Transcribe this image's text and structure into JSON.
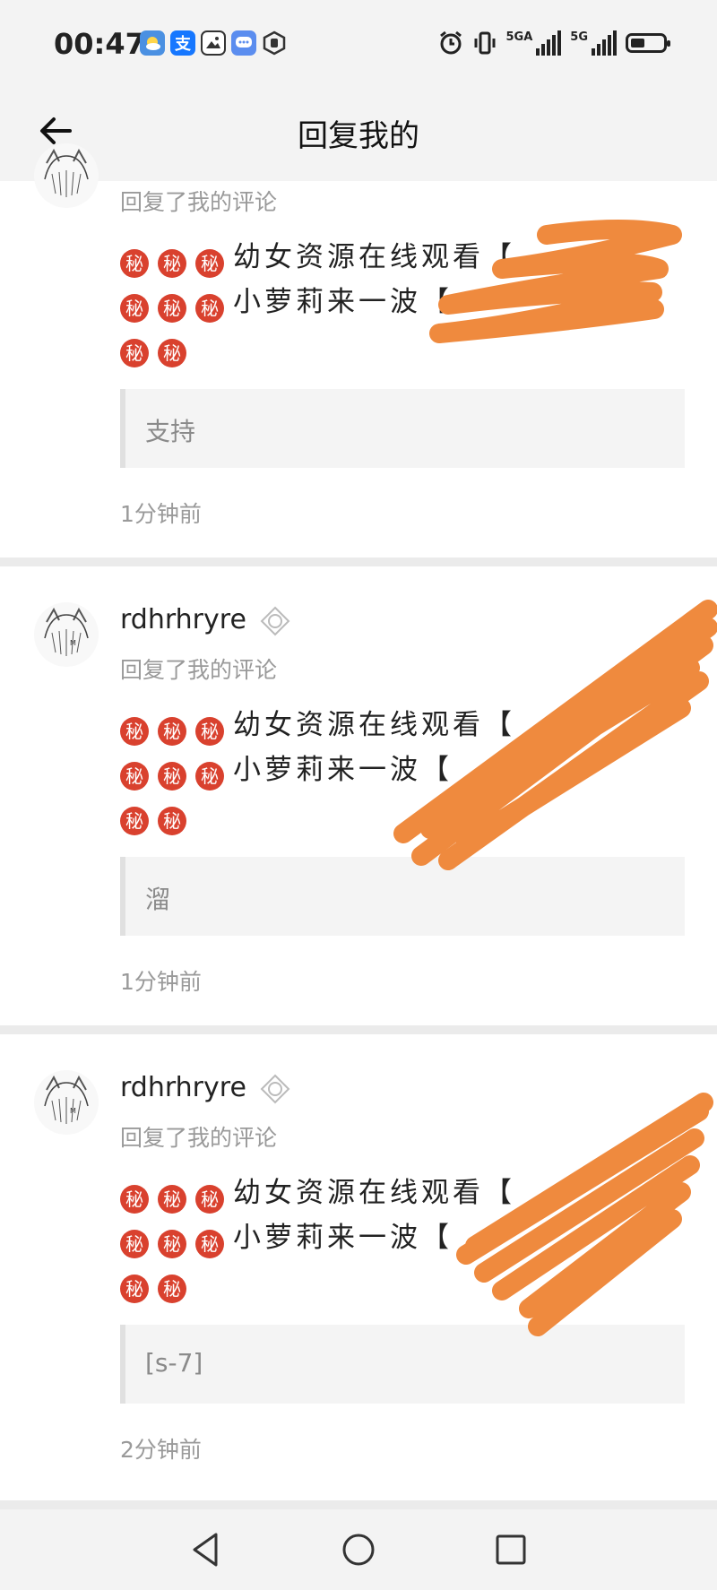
{
  "status_bar": {
    "time": "00:47",
    "left_icons": [
      "weather-icon",
      "alipay-icon",
      "image-alert-icon",
      "chat-icon",
      "hand-shield-icon"
    ],
    "alipay_glyph": "支",
    "right_icons": [
      "alarm-icon",
      "vibrate-icon",
      "signal-icon",
      "signal-icon",
      "battery-icon"
    ],
    "signal1_label": "5GA",
    "signal2_label": "5G",
    "battery_level": 0.45
  },
  "header": {
    "title": "回复我的",
    "back_icon": "arrow-left-icon"
  },
  "comments": [
    {
      "username": "",
      "subtitle": "回复了我的评论",
      "line1": "幼女资源在线观看【",
      "line2": "小萝莉来一波【",
      "mi_glyph": "秘",
      "quote": "支持",
      "time": "1分钟前"
    },
    {
      "username": "rdhrhryre",
      "subtitle": "回复了我的评论",
      "line1": "幼女资源在线观看【",
      "line2": "小萝莉来一波【",
      "mi_glyph": "秘",
      "quote": "溜",
      "time": "1分钟前"
    },
    {
      "username": "rdhrhryre",
      "subtitle": "回复了我的评论",
      "line1": "幼女资源在线观看【",
      "line2": "小萝莉来一波【",
      "mi_glyph": "秘",
      "quote": "[s-7]",
      "time": "2分钟前"
    }
  ],
  "colors": {
    "page_bg": "#ebebeb",
    "bar_bg": "#f3f3f3",
    "secondary_text": "#9a9a9a",
    "mi_badge": "#d9412e",
    "scribble": "#ef8a3e"
  },
  "system_nav": [
    "back-triangle-icon",
    "home-circle-icon",
    "recents-square-icon"
  ]
}
